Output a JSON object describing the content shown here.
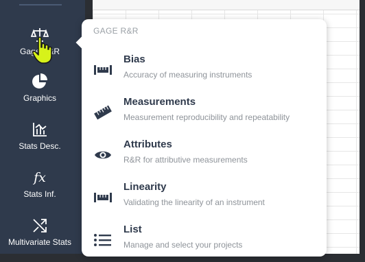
{
  "sidebar": {
    "items": [
      {
        "label": "Gage R&R",
        "icon": "scale-icon"
      },
      {
        "label": "Graphics",
        "icon": "pie-chart-icon"
      },
      {
        "label": "Stats Desc.",
        "icon": "bar-chart-icon"
      },
      {
        "label": "Stats Inf.",
        "icon": "fx-icon",
        "glyph": "fx"
      },
      {
        "label": "Multivariate Stats",
        "icon": "shuffle-icon"
      }
    ]
  },
  "popup": {
    "title": "GAGE R&R",
    "items": [
      {
        "title": "Bias",
        "desc": "Accuracy of measuring instruments",
        "icon": "bias-icon"
      },
      {
        "title": "Measurements",
        "desc": "Measurement reproducibility and repeatability",
        "icon": "ruler-icon"
      },
      {
        "title": "Attributes",
        "desc": "R&R for attributive measurements",
        "icon": "eye-icon"
      },
      {
        "title": "Linearity",
        "desc": "Validating the linearity of an instrument",
        "icon": "linearity-icon"
      },
      {
        "title": "List",
        "desc": "Manage and select your projects",
        "icon": "list-icon"
      }
    ]
  },
  "colors": {
    "sidebar_bg": "#2f3a4c",
    "popup_title": "#9aa0a6",
    "item_title": "#2f3a4c",
    "item_desc": "#8e9399",
    "cursor": "#d7f21a"
  }
}
